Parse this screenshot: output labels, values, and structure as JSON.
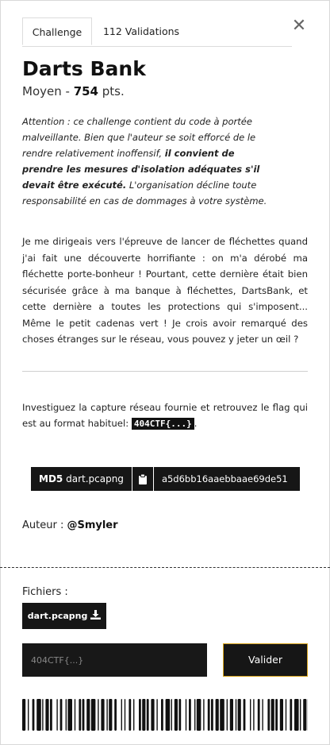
{
  "tabs": [
    {
      "label": "Challenge"
    },
    {
      "label": "112 Validations"
    }
  ],
  "close_glyph": "✕",
  "challenge": {
    "title": "Darts Bank",
    "difficulty": "Moyen",
    "separator": " - ",
    "points": "754",
    "points_unit": " pts."
  },
  "warning": {
    "part1": "Attention : ce challenge contient du code à portée malveillante. Bien que l'auteur se soit efforcé de le rendre relativement inoffensif, ",
    "bold": "il convient de prendre les mesures d'isolation adéquates s'il devait être exécuté.",
    "part2": " L'organisation décline toute responsabilité en cas de dommages à votre système."
  },
  "description": "Je me dirigeais vers l'épreuve de lancer de fléchettes quand j'ai fait une découverte horrifiante : on m'a dérobé ma fléchette porte-bonheur ! Pourtant, cette dernière était bien sécurisée grâce à ma banque à fléchettes, DartsBank, et cette dernière a toutes les protections qui s'imposent... Même le petit cadenas vert ! Je crois avoir remarqué des choses étranges sur le réseau, vous pouvez y jeter un œil ?",
  "task": {
    "text": "Investiguez la capture réseau fournie et retrouvez le flag qui est au format habituel: ",
    "code": "404CTF{...}",
    "end": "."
  },
  "hash": {
    "algo": "MD5",
    "file": "dart.pcapng",
    "value": "a5d6bb16aaebbaae69de51",
    "copy_icon": "clipboard-icon"
  },
  "author": {
    "label": "Auteur : ",
    "name": "@Smyler"
  },
  "files": {
    "label": "Fichiers :",
    "file_button": "dart.pcapng",
    "download_icon": "download-icon"
  },
  "flag_input": {
    "placeholder": "404CTF{...}",
    "value": ""
  },
  "submit_label": "Valider",
  "colors": {
    "dark": "#161616",
    "accent": "#d6a21a"
  }
}
